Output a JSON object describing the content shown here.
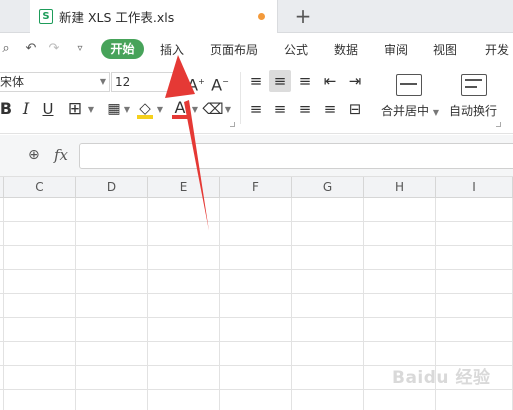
{
  "tab": {
    "icon_letter": "S",
    "title": "新建 XLS 工作表.xls",
    "new_tab": "+"
  },
  "menu": {
    "items": [
      "开始",
      "插入",
      "页面布局",
      "公式",
      "数据",
      "审阅",
      "视图",
      "开发"
    ],
    "active_index": 0
  },
  "ribbon": {
    "font_name": "宋体",
    "font_size": "12",
    "bold": "B",
    "italic": "I",
    "underline": "U",
    "merge_label": "合并居中",
    "wrap_label": "自动换行"
  },
  "formula": {
    "fx": "fx"
  },
  "columns": [
    "",
    "C",
    "D",
    "E",
    "F",
    "G",
    "H",
    "I"
  ],
  "watermark": "Baidu 经验",
  "colors": {
    "accent_green": "#47a35a",
    "annotation_red": "#e53935",
    "modified_dot": "#f39a3b"
  }
}
